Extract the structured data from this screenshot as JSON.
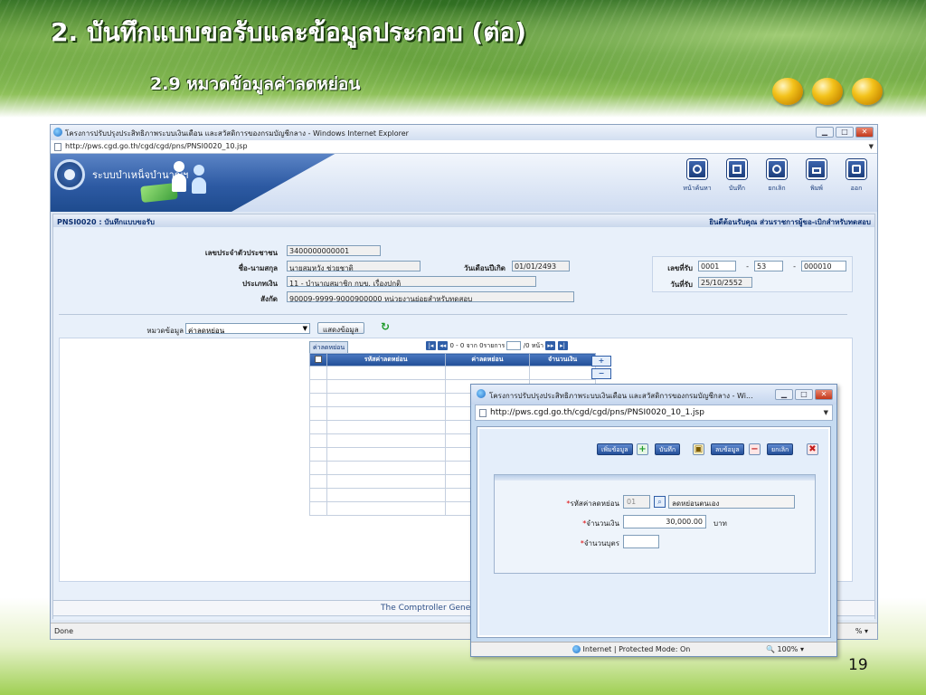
{
  "slide": {
    "title": "2. บันทึกแบบขอรับและข้อมูลประกอบ (ต่อ)",
    "subtitle": "2.9 หมวดข้อมูลค่าลดหย่อน",
    "page_number": "19",
    "accent_color": "#f3c21a"
  },
  "ie": {
    "window_title": "โครงการปรับปรุงประสิทธิภาพระบบเงินเดือน และสวัสดิการของกรมบัญชีกลาง - Windows Internet Explorer",
    "url": "http://pws.cgd.go.th/cgd/cgd/pns/PNSI0020_10.jsp",
    "status_left": "Done",
    "status_right": "% ▾"
  },
  "app": {
    "system_name": "ระบบบำเหน็จบำนาญฯ",
    "toolbar": [
      {
        "label": "หน้าค้นหา",
        "icon": "search-page-icon"
      },
      {
        "label": "บันทึก",
        "icon": "save-icon"
      },
      {
        "label": "ยกเลิก",
        "icon": "cancel-icon"
      },
      {
        "label": "พิมพ์",
        "icon": "print-icon"
      },
      {
        "label": "ออก",
        "icon": "exit-icon"
      }
    ],
    "page_code": "PNSI0020 : บันทึกแบบขอรับ",
    "welcome": "ยินดีต้อนรับคุณ ส่วนราชการผู้ขอ-เบิกสำหรับทดสอบ",
    "footer": "The Comptroller Gener"
  },
  "form": {
    "citizen_id_label": "เลขประจำตัวประชาชน",
    "citizen_id": "3400000000001",
    "name_label": "ชื่อ-นามสกุล",
    "name": "นายสมหวัง ช่วยชาติ",
    "birth_label": "วันเดือนปีเกิด",
    "birth": "01/01/2493",
    "money_type_label": "ประเภทเงิน",
    "money_type": "11 - บำนาญสมาชิก กบข. เรื่องปกติ",
    "unit_label": "สังกัด",
    "unit": "90009-9999-9000900000  หน่วยงานย่อยสำหรับทดสอบ",
    "receipt_no_label": "เลขที่รับ",
    "receipt_no_1": "0001",
    "receipt_no_2": "53",
    "receipt_no_3": "000010",
    "receipt_date_label": "วันที่รับ",
    "receipt_date": "25/10/2552",
    "category_label": "หมวดข้อมูล",
    "category_value": "ค่าลดหย่อน",
    "show_button": "แสดงข้อมูล"
  },
  "grid": {
    "tab_label": "ค่าลดหย่อน",
    "pager_text": "0 - 0 จาก 0รายการ",
    "pager_page": "0",
    "pager_suffix": "/0 หน้า",
    "columns": [
      "รหัสค่าลดหย่อน",
      "ค่าลดหย่อน",
      "จำนวนเงิน"
    ],
    "add_row": "+",
    "del_row": "−"
  },
  "popup": {
    "window_title": "โครงการปรับปรุงประสิทธิภาพระบบเงินเดือน และสวัสดิการของกรมบัญชีกลาง - Wi...",
    "url": "http://pws.cgd.go.th/cgd/cgd/pns/PNSI0020_10_1.jsp",
    "buttons": {
      "add": "เพิ่มข้อมูล",
      "save": "บันทึก",
      "delete": "ลบข้อมูล",
      "cancel": "ยกเลิก"
    },
    "code_label": "รหัสค่าลดหย่อน",
    "code_value": "01",
    "code_desc": "ลดหย่อนตนเอง",
    "amount_label": "จำนวนเงิน",
    "amount_value": "30,000.00",
    "amount_unit": "บาท",
    "children_label": "จำนวนบุตร",
    "children_value": "",
    "status_zone": "Internet | Protected Mode: On",
    "status_zoom": "100%"
  }
}
